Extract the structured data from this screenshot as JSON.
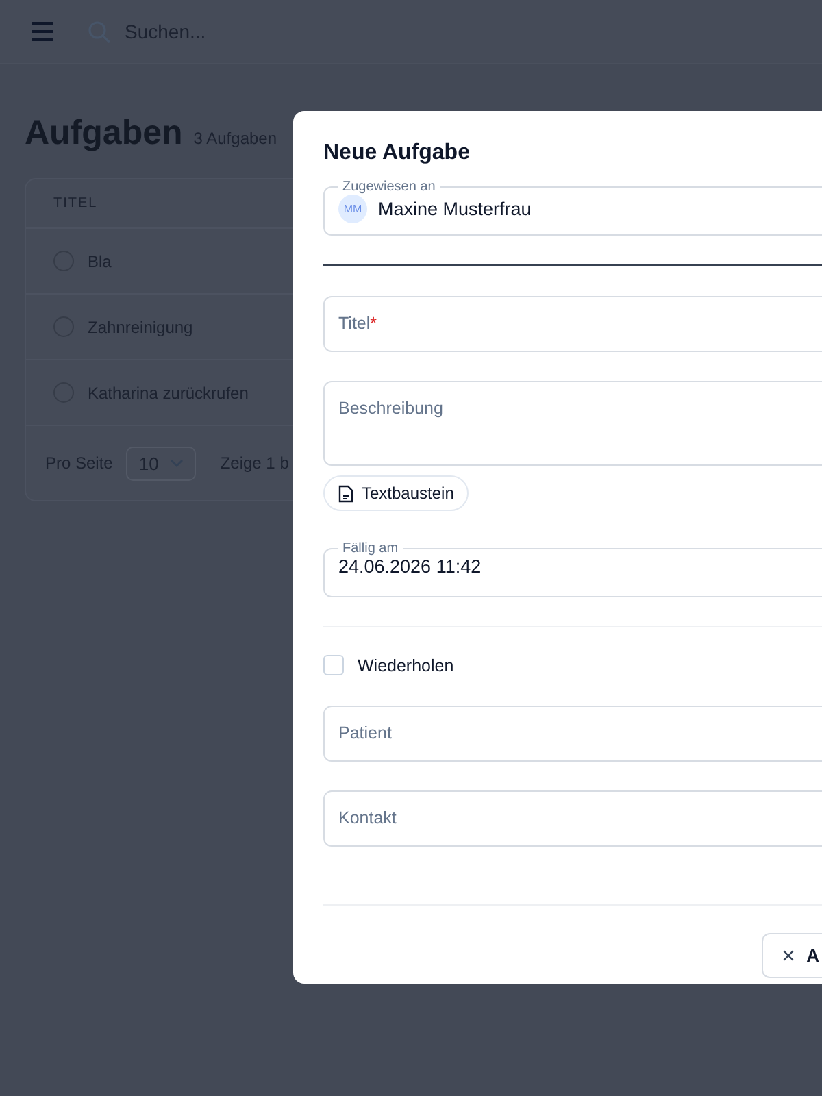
{
  "header": {
    "search_placeholder": "Suchen..."
  },
  "page": {
    "title": "Aufgaben",
    "count": "3 Aufgaben"
  },
  "table": {
    "columns": [
      "TITEL"
    ],
    "rows": [
      {
        "title": "Bla",
        "checked": false
      },
      {
        "title": "Zahnreinigung",
        "checked": false
      },
      {
        "title": "Katharina zurückrufen",
        "checked": false
      }
    ],
    "footer": {
      "per_page_label": "Pro Seite",
      "per_page": "10",
      "range": "Zeige 1 b"
    }
  },
  "dialog": {
    "title": "Neue Aufgabe",
    "fields": [
      {
        "kind": "person",
        "label": "Zugewiesen an",
        "initials": "MM",
        "value": "Maxine Musterfrau"
      },
      {
        "kind": "rule"
      },
      {
        "kind": "text",
        "placeholder": "Titel",
        "required_mark": "*"
      },
      {
        "kind": "textarea",
        "placeholder": "Beschreibung"
      },
      {
        "kind": "chip",
        "label": "Textbaustein"
      },
      {
        "kind": "date",
        "label": "Fällig am",
        "value": "24.06.2026 11:42"
      },
      {
        "kind": "divider"
      },
      {
        "kind": "checkbox",
        "label": "Wiederholen",
        "checked": false
      },
      {
        "kind": "text",
        "placeholder": "Patient"
      },
      {
        "kind": "text",
        "placeholder": "Kontakt"
      },
      {
        "kind": "divider"
      }
    ],
    "buttons": [
      {
        "label": "A"
      }
    ]
  }
}
